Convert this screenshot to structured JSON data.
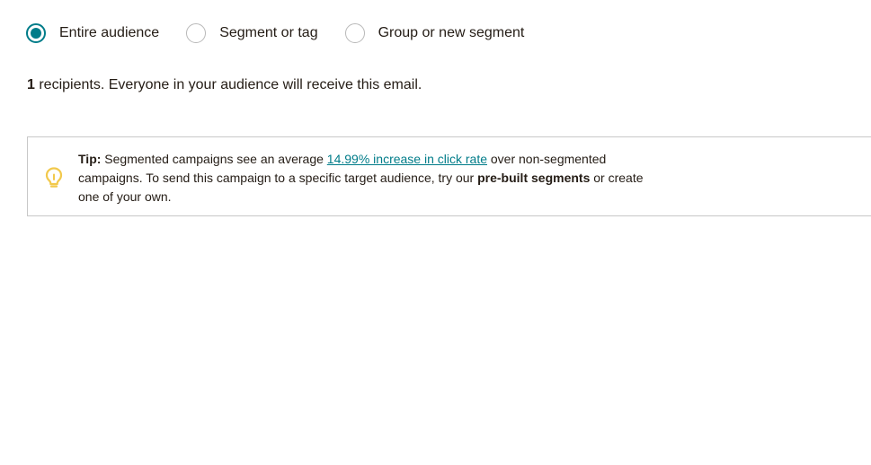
{
  "audience_options": [
    {
      "label": "Entire audience",
      "checked": true
    },
    {
      "label": "Segment or tag",
      "checked": false
    },
    {
      "label": "Group or new segment",
      "checked": false
    }
  ],
  "recipients": {
    "count": "1",
    "text": " recipients. Everyone in your audience will receive this email."
  },
  "tip": {
    "icon": "lightbulb-icon",
    "prefix": "Tip:",
    "text_1": " Segmented campaigns see an average ",
    "link_text": "14.99% increase in click rate",
    "text_2": " over non-segmented campaigns. To send this campaign to a specific target audience, try our ",
    "bold_text": "pre-built segments",
    "text_3": " or create one of your own."
  },
  "colors": {
    "accent": "#007c89",
    "text": "#241c15",
    "tip_icon": "#f2c94c",
    "border": "#c8c8c8"
  }
}
